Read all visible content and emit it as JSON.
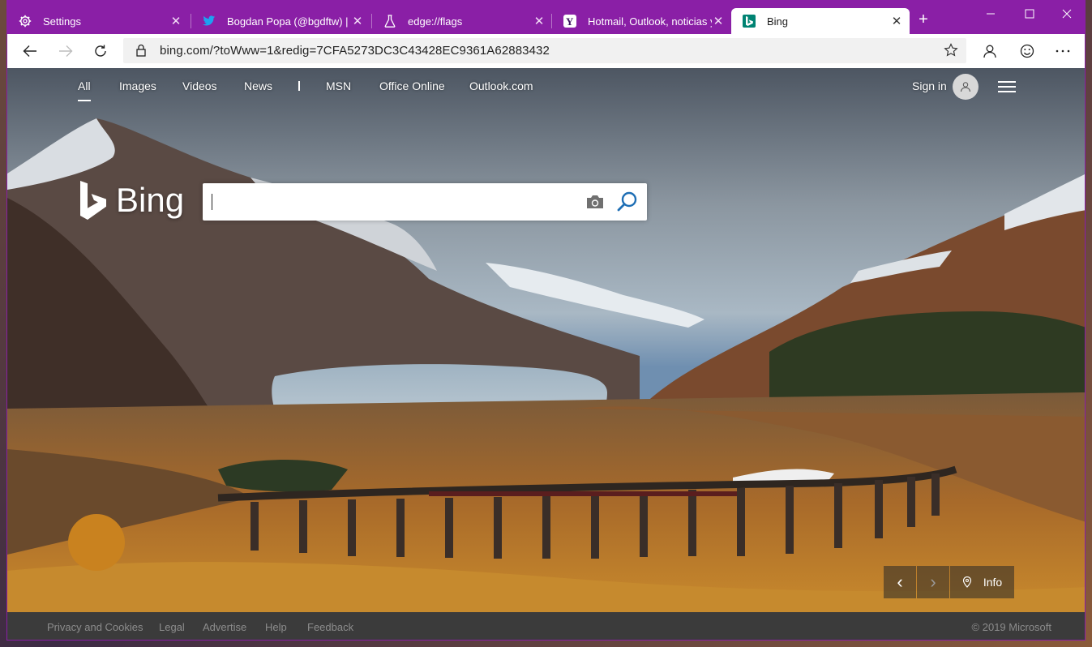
{
  "tabs": [
    {
      "title": "Settings",
      "icon": "gear-icon",
      "active": false
    },
    {
      "title": "Bogdan Popa (@bgdftw) | Tw",
      "icon": "twitter-icon",
      "active": false
    },
    {
      "title": "edge://flags",
      "icon": "flask-icon",
      "active": false
    },
    {
      "title": "Hotmail, Outlook, noticias y h",
      "icon": "yahoo-icon",
      "active": false
    },
    {
      "title": "Bing",
      "icon": "bing-icon",
      "active": true
    }
  ],
  "newtab_label": "+",
  "address": {
    "url": "bing.com/?toWww=1&redig=7CFA5273DC3C43428EC9361A62883432"
  },
  "nav": {
    "links": [
      "All",
      "Images",
      "Videos",
      "News",
      "MSN",
      "Office Online",
      "Outlook.com"
    ],
    "active": "All",
    "signin": "Sign in"
  },
  "logo_text": "Bing",
  "search": {
    "value": "",
    "placeholder": ""
  },
  "carousel": {
    "prev": "‹",
    "next": "›",
    "info_label": "Info"
  },
  "footer": {
    "links": [
      "Privacy and Cookies",
      "Legal",
      "Advertise",
      "Help",
      "Feedback"
    ],
    "copyright": "© 2019 Microsoft"
  },
  "colors": {
    "accent": "#8a1fa6",
    "bing_blue": "#1f6fb5",
    "footer_bg": "#3b3b3b"
  }
}
